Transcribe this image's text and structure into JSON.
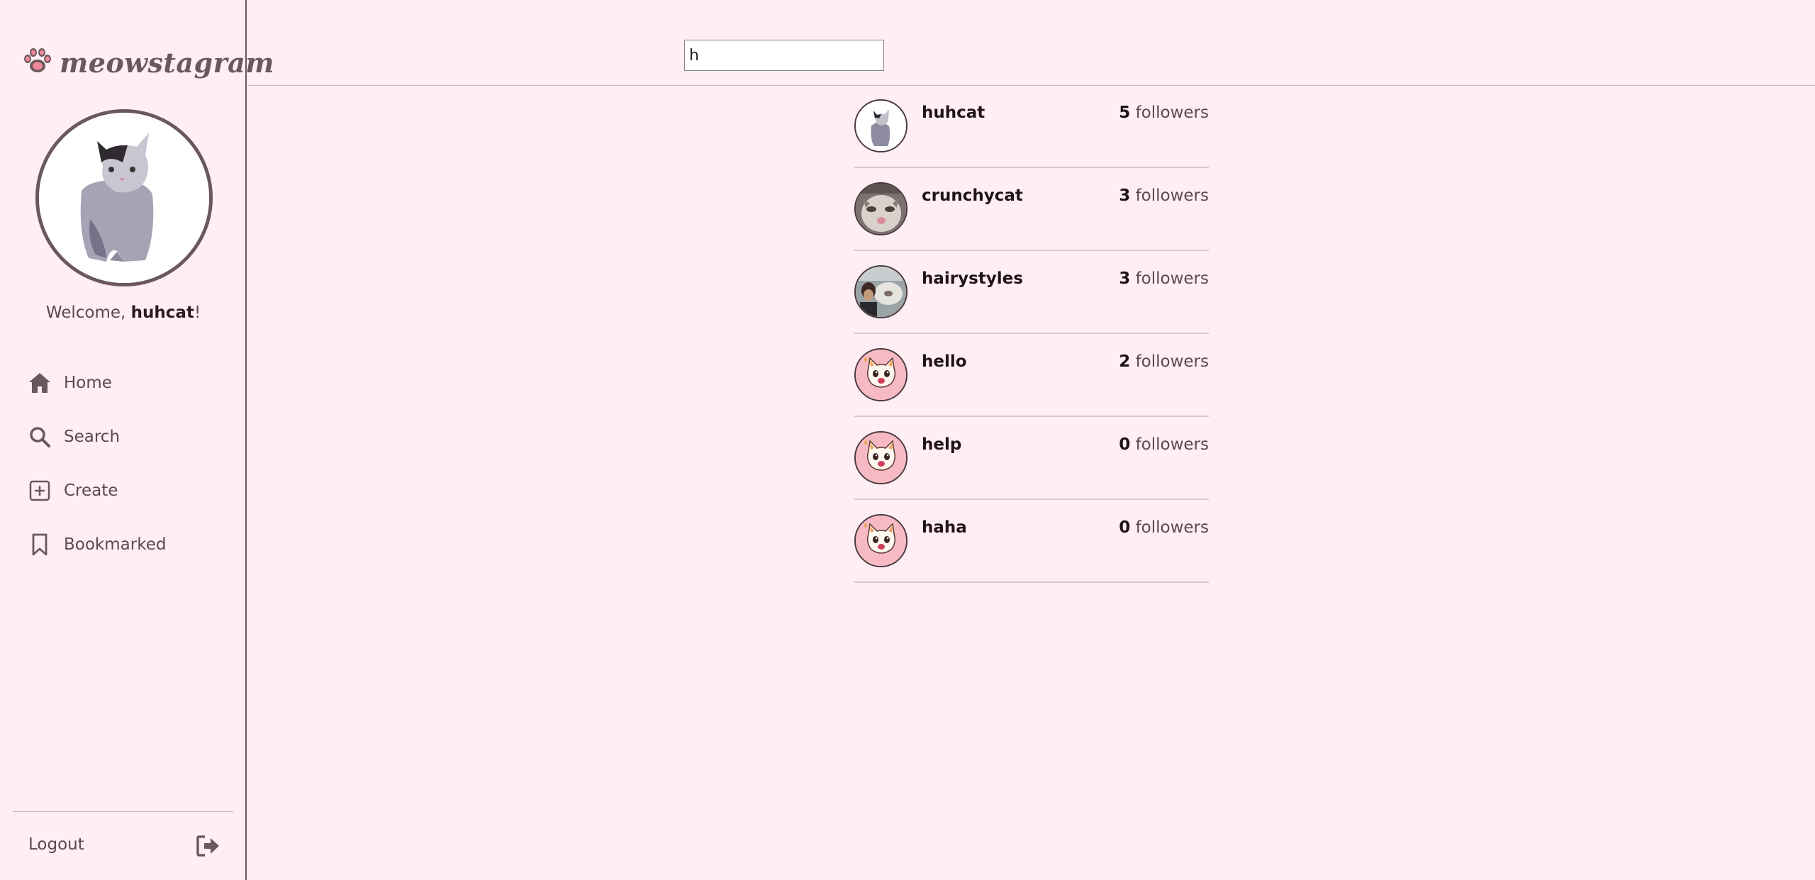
{
  "app": {
    "name": "meowstagram",
    "brand_color": "#6b585e",
    "background": "#ffeef3"
  },
  "sidebar": {
    "welcome_prefix": "Welcome, ",
    "username": "huhcat",
    "welcome_suffix": "!",
    "nav": [
      {
        "label": "Home",
        "icon": "home-icon"
      },
      {
        "label": "Search",
        "icon": "search-icon"
      },
      {
        "label": "Create",
        "icon": "plus-square-icon"
      },
      {
        "label": "Bookmarked",
        "icon": "bookmark-icon"
      }
    ],
    "logout_label": "Logout",
    "logout_icon": "logout-icon"
  },
  "search": {
    "value": "h"
  },
  "results": [
    {
      "username": "huhcat",
      "followers": "5",
      "followers_label": "followers",
      "avatar": "grey-cat-photo"
    },
    {
      "username": "crunchycat",
      "followers": "3",
      "followers_label": "followers",
      "avatar": "crunchy-cat-photo"
    },
    {
      "username": "hairystyles",
      "followers": "3",
      "followers_label": "followers",
      "avatar": "person-with-cat-photo"
    },
    {
      "username": "hello",
      "followers": "2",
      "followers_label": "followers",
      "avatar": "default-cartoon-cat"
    },
    {
      "username": "help",
      "followers": "0",
      "followers_label": "followers",
      "avatar": "default-cartoon-cat"
    },
    {
      "username": "haha",
      "followers": "0",
      "followers_label": "followers",
      "avatar": "default-cartoon-cat"
    }
  ]
}
